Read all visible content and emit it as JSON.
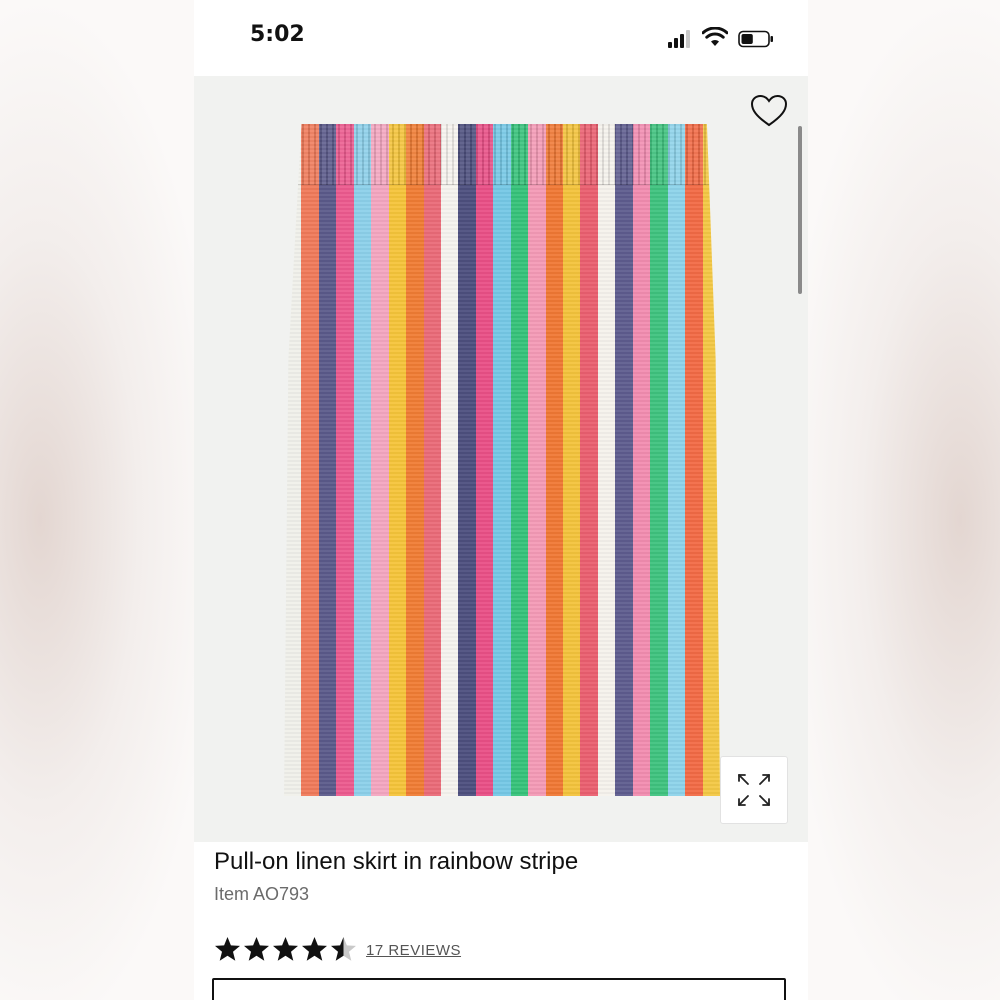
{
  "status_bar": {
    "time": "5:02",
    "signal_icon": "cellular-signal-icon",
    "wifi_icon": "wifi-icon",
    "battery_icon": "battery-icon",
    "battery_level": 0.45
  },
  "product_image": {
    "favorite_icon": "heart-icon",
    "expand_icon": "expand-arrows-icon",
    "stripe_colors": [
      "#f0f0ea",
      "#f07a5a",
      "#5b5a8a",
      "#ec5a8e",
      "#8cd0ea",
      "#f4a6c0",
      "#f5c43a",
      "#f07c34",
      "#ea6a78",
      "#f6f3ee",
      "#4d4f7e",
      "#e94f86",
      "#75c8e6",
      "#36c27a",
      "#f49ab6",
      "#f07834",
      "#f3c33c",
      "#ea5f6f",
      "#f5f2ec",
      "#5e5c8e",
      "#f28cb0",
      "#3fc27e",
      "#8dd3ea",
      "#f26a45",
      "#f3c844"
    ]
  },
  "product": {
    "title": "Pull-on linen skirt in rainbow stripe",
    "item_number": "Item AO793",
    "rating": 4.5,
    "rating_max": 5,
    "reviews_label": "17 REVIEWS"
  }
}
